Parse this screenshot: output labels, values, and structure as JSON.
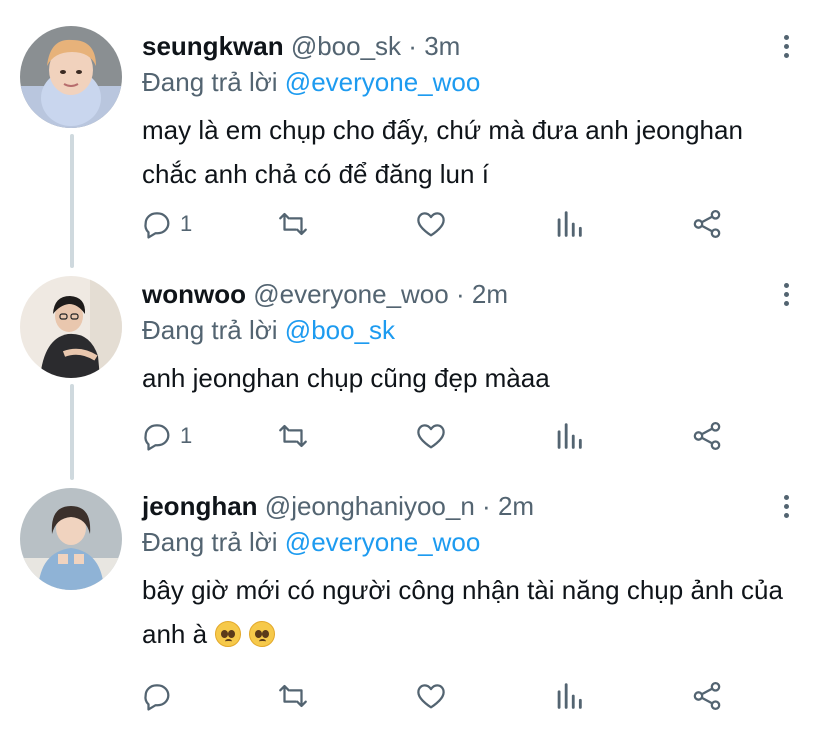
{
  "tweets": [
    {
      "name": "seungkwan",
      "handle": "@boo_sk",
      "sep": "·",
      "time": "3m",
      "reply_prefix": "Đang trả lời",
      "reply_to": "@everyone_woo",
      "text": "may là em chụp cho đấy, chứ mà đưa anh jeonghan chắc anh chả có để đăng lun í",
      "reply_count": "1",
      "avatar": "avatar-seungkwan"
    },
    {
      "name": "wonwoo",
      "handle": "@everyone_woo",
      "sep": "·",
      "time": "2m",
      "reply_prefix": "Đang trả lời",
      "reply_to": "@boo_sk",
      "text": "anh jeonghan chụp cũng đẹp màaa",
      "reply_count": "1",
      "avatar": "avatar-wonwoo"
    },
    {
      "name": "jeonghan",
      "handle": "@jeonghaniyoo_n",
      "sep": "·",
      "time": "2m",
      "reply_prefix": "Đang trả lời",
      "reply_to": "@everyone_woo",
      "text": "bây giờ mới có người công nhận tài năng chụp ảnh của anh à",
      "reply_count": "",
      "avatar": "avatar-jeonghan",
      "emojis": [
        "pleading-face-emoji",
        "pleading-face-emoji"
      ]
    }
  ],
  "icons": [
    "reply-icon",
    "retweet-icon",
    "like-icon",
    "analytics-icon",
    "share-icon",
    "more-icon"
  ],
  "colors": {
    "accent": "#1d9bf0",
    "muted": "#536471",
    "text": "#0f1419",
    "thread_line": "#cfd9de"
  }
}
